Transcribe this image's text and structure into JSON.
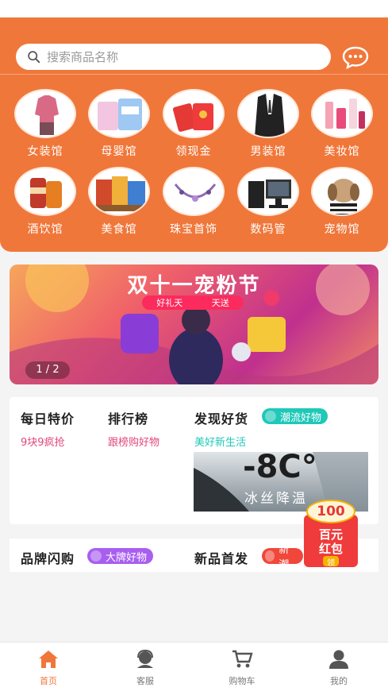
{
  "search": {
    "placeholder": "搜索商品名称"
  },
  "categories": [
    {
      "label": "女装馆",
      "icon": "clothing-icon"
    },
    {
      "label": "母婴馆",
      "icon": "baby-icon"
    },
    {
      "label": "领现金",
      "icon": "cash-icon"
    },
    {
      "label": "男装馆",
      "icon": "suit-icon"
    },
    {
      "label": "美妆馆",
      "icon": "cosmetics-icon"
    },
    {
      "label": "酒饮馆",
      "icon": "drinks-icon"
    },
    {
      "label": "美食馆",
      "icon": "food-icon"
    },
    {
      "label": "珠宝首饰",
      "icon": "jewelry-icon"
    },
    {
      "label": "数码管",
      "icon": "computer-icon"
    },
    {
      "label": "宠物馆",
      "icon": "pet-icon"
    }
  ],
  "banner": {
    "title": "双十一宠粉节",
    "sub_left": "好礼天",
    "sub_right": "天送",
    "pager": "1 / 2"
  },
  "sections": {
    "daily": {
      "title": "每日特价",
      "sub": "9块9疯抢"
    },
    "ranking": {
      "title": "排行榜",
      "sub": "跟榜购好物"
    },
    "discover": {
      "title": "发现好货",
      "pill": "潮流好物",
      "sub": "美好新生活"
    },
    "brand": {
      "title": "品牌闪购",
      "pill": "大牌好物"
    },
    "newitem": {
      "title": "新品首发",
      "pill": "新潮"
    }
  },
  "promo": {
    "temp": "-8C°",
    "text": "冰丝降温"
  },
  "redpacket": {
    "amount": "100",
    "line1": "百元",
    "line2": "红包",
    "action": "领"
  },
  "tabbar": [
    {
      "label": "首页",
      "icon": "home-icon",
      "active": true
    },
    {
      "label": "客服",
      "icon": "customer-service-icon",
      "active": false
    },
    {
      "label": "购物车",
      "icon": "cart-icon",
      "active": false
    },
    {
      "label": "我的",
      "icon": "profile-icon",
      "active": false
    }
  ],
  "colors": {
    "brand": "#f0773a",
    "pink": "#e2477c",
    "teal": "#1fc8b8",
    "purple": "#a85ef0",
    "red": "#f0473a"
  }
}
